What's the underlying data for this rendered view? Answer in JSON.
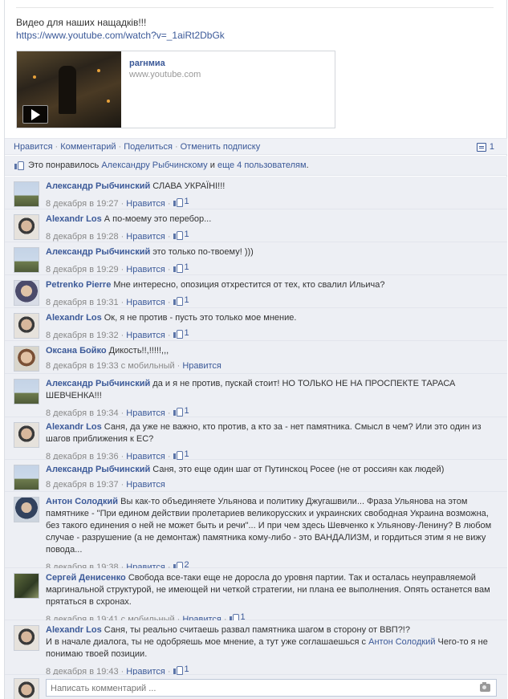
{
  "post": {
    "text": "Видео для наших нащадків!!!",
    "url": "https://www.youtube.com/watch?v=_1aiRt2DbGk",
    "share": {
      "title": "pаrнмиа",
      "domain": "www.youtube.com",
      "play_icon": "play-icon"
    }
  },
  "actions": {
    "like": "Нравится",
    "comment": "Комментарий",
    "share": "Поделиться",
    "unsubscribe": "Отменить подписку",
    "sep": "·",
    "comment_count": "1"
  },
  "likes_summary": {
    "prefix": "Это понравилось",
    "person": "Александру Рыбчинскому",
    "middle": "и",
    "others": "еще 4 пользователям",
    "suffix": "."
  },
  "comments": [
    {
      "author": "Александр Рыбчинский",
      "text": "СЛАВА УКРАЇНІ!!!",
      "date": "8 декабря в 19:27",
      "like": "Нравится",
      "likes": "1"
    },
    {
      "author": "Alexandr Los",
      "text": "А по-моему это перебор...",
      "date": "8 декабря в 19:28",
      "like": "Нравится",
      "likes": "1"
    },
    {
      "author": "Александр Рыбчинский",
      "text": "это только по-твоему! )))",
      "date": "8 декабря в 19:29",
      "like": "Нравится",
      "likes": "1"
    },
    {
      "author": "Petrenko Pierre",
      "text": "Мне интересно, опозиция отхрестится от тех, кто свалил Ильича?",
      "date": "8 декабря в 19:31",
      "like": "Нравится",
      "likes": "1"
    },
    {
      "author": "Alexandr Los",
      "text": "Ок, я не против - пусть это только мое мнение.",
      "date": "8 декабря в 19:32",
      "like": "Нравится",
      "likes": "1"
    },
    {
      "author": "Оксана Бойко",
      "text": "Дикость!!,!!!!!,,,",
      "date": "8 декабря в 19:33 с мобильный",
      "like": "Нравится",
      "likes": ""
    },
    {
      "author": "Александр Рыбчинский",
      "text": "да и я не против, пускай стоит! НО ТОЛЬКО НЕ НА ПРОСПЕКТЕ ТАРАСА ШЕВЧЕНКА!!!",
      "date": "8 декабря в 19:34",
      "like": "Нравится",
      "likes": "1"
    },
    {
      "author": "Alexandr Los",
      "text": "Саня, да уже не важно, кто против, а кто за - нет памятника. Смысл в чем? Или это один из шагов приближения к ЕС?",
      "date": "8 декабря в 19:36",
      "like": "Нравится",
      "likes": "1"
    },
    {
      "author": "Александр Рыбчинский",
      "text": "Саня, это еще один шаг от Путинскоц Росее (не от россиян как людей)",
      "date": "8 декабря в 19:37",
      "like": "Нравится",
      "likes": ""
    },
    {
      "author": "Антон Солодкий",
      "text": "Вы как-то объединяете Ульянова и политику Джугашвили... Фраза Ульянова на этом памятнике - \"При едином действии пролетариев великорусских и украинских свободная Украина возможна, без такого единения о ней не может быть и речи\"... И при чем здесь Шевченко к Ульянову-Ленину? В любом случае - разрушение (а не демонтаж) памятника кому-либо - это ВАНДАЛИЗМ, и гордиться этим я не вижу повода...",
      "date": "8 декабря в 19:38",
      "like": "Нравится",
      "likes": "2"
    },
    {
      "author": "Сергей Денисенко",
      "text": "Свобода все-таки еще не доросла до уровня партии. Так и осталась неуправляемой маргинальной структурой, не имеющей ни четкой стратегии, ни плана ее выполнения. Опять останется вам прятаться в схронах.",
      "date": "8 декабря в 19:41 с мобильный",
      "like": "Нравится",
      "likes": "1"
    },
    {
      "author": "Alexandr Los",
      "text": "Саня, ты реально считаешь развал памятника шагом в сторону от ВВП?!?",
      "text2a": "И в начале диалога, ты не одобряешь мое мнение, а тут уже соглашаешься с",
      "mention": "Антон Солодкий",
      "text2b": "Чего-то я не понимаю твоей позиции.",
      "date": "8 декабря в 19:43",
      "like": "Нравится",
      "likes": "1"
    }
  ],
  "composer": {
    "placeholder": "Написать комментарий ..."
  }
}
